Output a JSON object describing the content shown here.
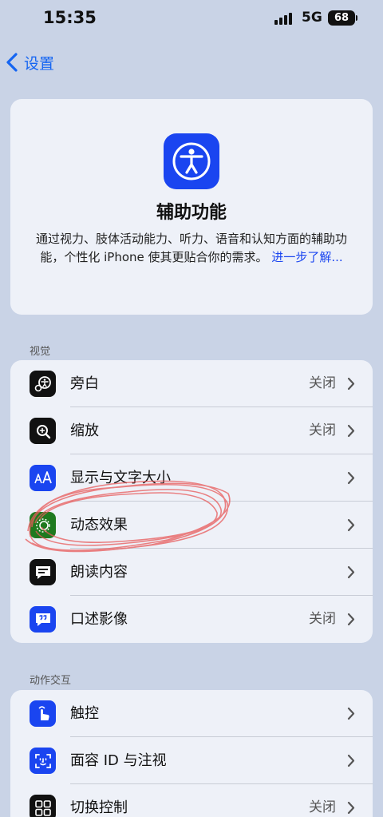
{
  "status_bar": {
    "time": "15:35",
    "network": "5G",
    "battery": "68"
  },
  "nav": {
    "back_label": "设置"
  },
  "hero": {
    "icon": "accessibility-icon",
    "title": "辅助功能",
    "description": "通过视力、肢体活动能力、听力、语音和认知方面的辅助功能，个性化 iPhone 使其更贴合你的需求。",
    "link": "进一步了解..."
  },
  "sections": [
    {
      "header": "视觉",
      "rows": [
        {
          "label": "旁白",
          "value": "关闭",
          "icon": "voiceover-icon",
          "color": "#111111"
        },
        {
          "label": "缩放",
          "value": "关闭",
          "icon": "zoom-icon",
          "color": "#111111"
        },
        {
          "label": "显示与文字大小",
          "value": "",
          "icon": "text-size-icon",
          "color": "#1a45f0"
        },
        {
          "label": "动态效果",
          "value": "",
          "icon": "motion-icon",
          "color": "#1f7a1f"
        },
        {
          "label": "朗读内容",
          "value": "",
          "icon": "spoken-content-icon",
          "color": "#111111"
        },
        {
          "label": "口述影像",
          "value": "关闭",
          "icon": "audio-description-icon",
          "color": "#1a45f0"
        }
      ]
    },
    {
      "header": "动作交互",
      "rows": [
        {
          "label": "触控",
          "value": "",
          "icon": "touch-icon",
          "color": "#1a45f0"
        },
        {
          "label": "面容 ID 与注视",
          "value": "",
          "icon": "face-id-icon",
          "color": "#1a45f0"
        },
        {
          "label": "切换控制",
          "value": "关闭",
          "icon": "switch-control-icon",
          "color": "#111111"
        }
      ]
    }
  ],
  "colors": {
    "background": "#c9d3e6",
    "card": "#eef1f8",
    "accent": "#1a45f0",
    "annotation": "#e23b3b"
  }
}
